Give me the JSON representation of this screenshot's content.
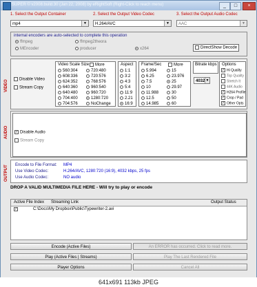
{
  "window": {
    "title": "SUPER © v2008.build.30 (Jan 22, 2008) by eRightSoft    (Right-Click to reach menu)",
    "controls": [
      "_",
      "□",
      "×"
    ]
  },
  "container": {
    "label": "1.   Select the Output Container",
    "value": "mp4"
  },
  "video_codec": {
    "label": "2.   Select the Output Video Codec",
    "value": "H.264/AVC"
  },
  "audio_codec": {
    "label": "3.   Select the Output Audio Codec",
    "value": "AAC"
  },
  "encoders": {
    "note": "internal encoders are auto-selected to complete this operation",
    "items": [
      {
        "label": "ffmpeg",
        "on": true
      },
      {
        "label": "ffmpeg2theora",
        "on": false
      },
      {
        "label": "MEncoder",
        "on": false
      },
      {
        "label": "producer",
        "on": false
      },
      {
        "label": "x264",
        "on": true
      }
    ],
    "directshow": "DirectShow Decode"
  },
  "video": {
    "section_label": "VIDEO",
    "disable": "Disable Video",
    "stream_copy": "Stream Copy",
    "scale_title": "Video Scale Size",
    "scale_more": "More",
    "scale_col1": [
      "560:304",
      "608:336",
      "624:352",
      "640:360",
      "640:480",
      "704:400",
      "704:576"
    ],
    "scale_col2": [
      "720:480",
      "720:576",
      "768:576",
      "960:540",
      "960:720",
      "1280:720",
      "NoChange"
    ],
    "scale_selected": "1280:720",
    "aspect_title": "Aspect",
    "aspect": [
      "1:1",
      "3:2",
      "4:3",
      "5:4",
      "11:9",
      "2.21",
      "16:9"
    ],
    "aspect_selected": "16:9",
    "fps_title": "Frame/Sec",
    "fps_more": "More",
    "fps_col1": [
      "5.994",
      "6.25",
      "7.5",
      "10",
      "11.988",
      "12.5",
      "14.985"
    ],
    "fps_col2": [
      "15",
      "23.976",
      "25",
      "29.97",
      "30",
      "50",
      "60"
    ],
    "fps_selected": "25",
    "bitrate_title": "Bitrate  kbps",
    "bitrate_value": "4032",
    "options_title": "Options",
    "options": [
      {
        "label": "Hi Quality",
        "on": true
      },
      {
        "label": "Top Quality",
        "on": false
      },
      {
        "label": "Stretch It",
        "on": false
      },
      {
        "label": "44K Audio",
        "on": false
      },
      {
        "label": "H264 Profile",
        "on": true
      },
      {
        "label": "Crop / Pad",
        "on": true
      },
      {
        "label": "Other Opts",
        "on": true
      }
    ]
  },
  "audio": {
    "section_label": "AUDIO",
    "disable": "Disable Audio",
    "stream_copy": "Stream Copy"
  },
  "output": {
    "section_label": "OUTPUT",
    "rows": [
      {
        "label": "Encode to File Format:",
        "value": "MP4"
      },
      {
        "label": "Use Video Codec:",
        "value": "H.264/AVC, 1280:720 (16:9),  4032 kbps,  25 fps"
      },
      {
        "label": "Use Audio Codec:",
        "value": "NO audio"
      }
    ]
  },
  "drop_hint": "DROP A VALID MULTIMEDIA FILE HERE - Will try to play or encode",
  "file_table": {
    "headers": [
      "Active",
      "File Index",
      "Streaming Link",
      "Output Status"
    ],
    "rows": [
      {
        "active": true,
        "index": "1",
        "link": "C:\\Docs\\My Dropbox\\Public\\Typewriter-2.avi",
        "status": ""
      }
    ]
  },
  "buttons": {
    "encode": "Encode (Active Files)",
    "error": "An ERROR has occurred. Click to read more.",
    "play": "Play (Active Files | Streams)",
    "play_last": "Play The Last Rendered File",
    "player_options": "Player Options",
    "cancel_all": "Cancel All"
  },
  "caption": "641x691  113kb  JPEG"
}
